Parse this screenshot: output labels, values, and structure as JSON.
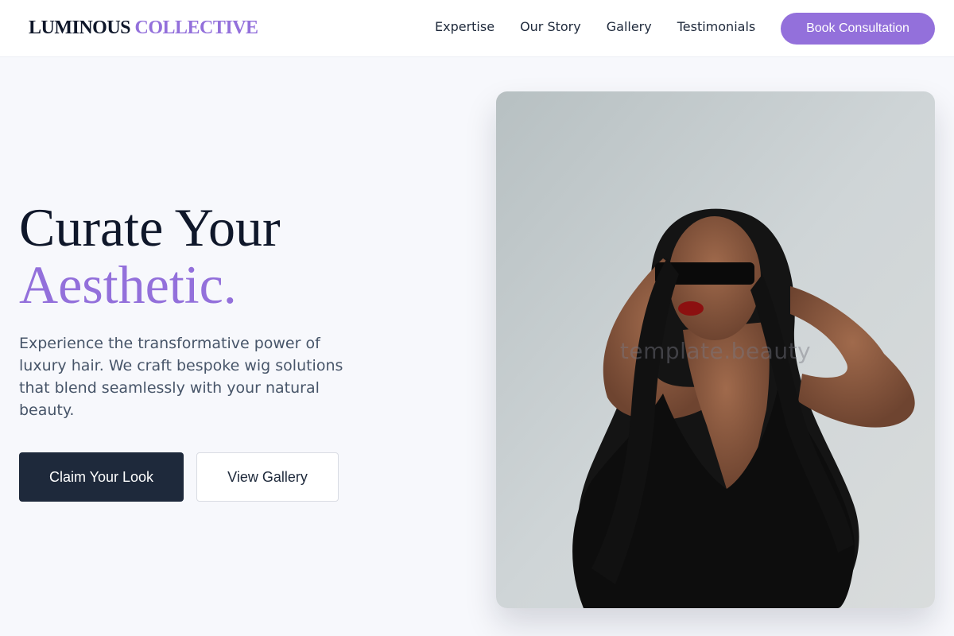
{
  "brand": {
    "word1": "LUMINOUS",
    "word2": "COLLECTIVE"
  },
  "nav": {
    "items": [
      "Expertise",
      "Our Story",
      "Gallery",
      "Testimonials"
    ],
    "cta": "Book Consultation"
  },
  "hero": {
    "headline_line1": "Curate Your",
    "headline_line2": "Aesthetic.",
    "subtext": "Experience the transformative power of luxury hair. We craft bespoke wig solutions that blend seamlessly with your natural beauty.",
    "primary_button": "Claim Your Look",
    "secondary_button": "View Gallery",
    "image_watermark": "template.beauty"
  },
  "colors": {
    "accent": "#9370db",
    "dark": "#1e293b",
    "background": "#f7f8fc"
  }
}
